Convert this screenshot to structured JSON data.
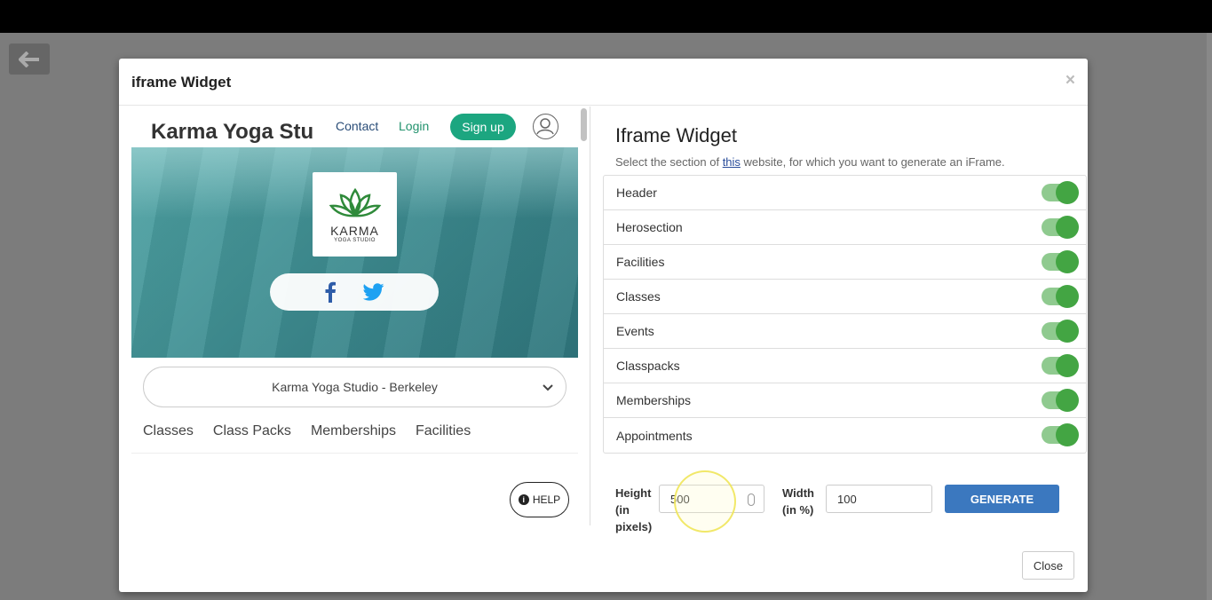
{
  "modal": {
    "title": "iframe Widget",
    "close_x": "×",
    "close_button": "Close"
  },
  "preview": {
    "brand": "Karma Yoga Studio",
    "nav": {
      "contact": "Contact",
      "login": "Login",
      "signup": "Sign up"
    },
    "logo": {
      "name": "KARMA",
      "sub": "YOGA STUDIO"
    },
    "studio_select": "Karma Yoga Studio - Berkeley",
    "tabs": [
      "Classes",
      "Class Packs",
      "Memberships",
      "Facilities"
    ],
    "help": "HELP",
    "help_badge": "i"
  },
  "panel": {
    "title": "Iframe Widget",
    "subtitle_pre": "Select the section of ",
    "subtitle_link": "this",
    "subtitle_post": " website, for which you want to generate an iFrame.",
    "sections": [
      {
        "label": "Header",
        "enabled": true
      },
      {
        "label": "Herosection",
        "enabled": true
      },
      {
        "label": "Facilities",
        "enabled": true
      },
      {
        "label": "Classes",
        "enabled": true
      },
      {
        "label": "Events",
        "enabled": true
      },
      {
        "label": "Classpacks",
        "enabled": true
      },
      {
        "label": "Memberships",
        "enabled": true
      },
      {
        "label": "Appointments",
        "enabled": true
      }
    ],
    "height_label_1": "Height",
    "height_label_2": "(in",
    "height_label_3": "pixels)",
    "height_value": "500",
    "width_label_1": "Width",
    "width_label_2": "(in %)",
    "width_value": "100",
    "generate": "GENERATE"
  },
  "colors": {
    "accent_green": "#1ca680",
    "toggle_on": "#43a543",
    "primary_blue": "#3b78bf"
  }
}
